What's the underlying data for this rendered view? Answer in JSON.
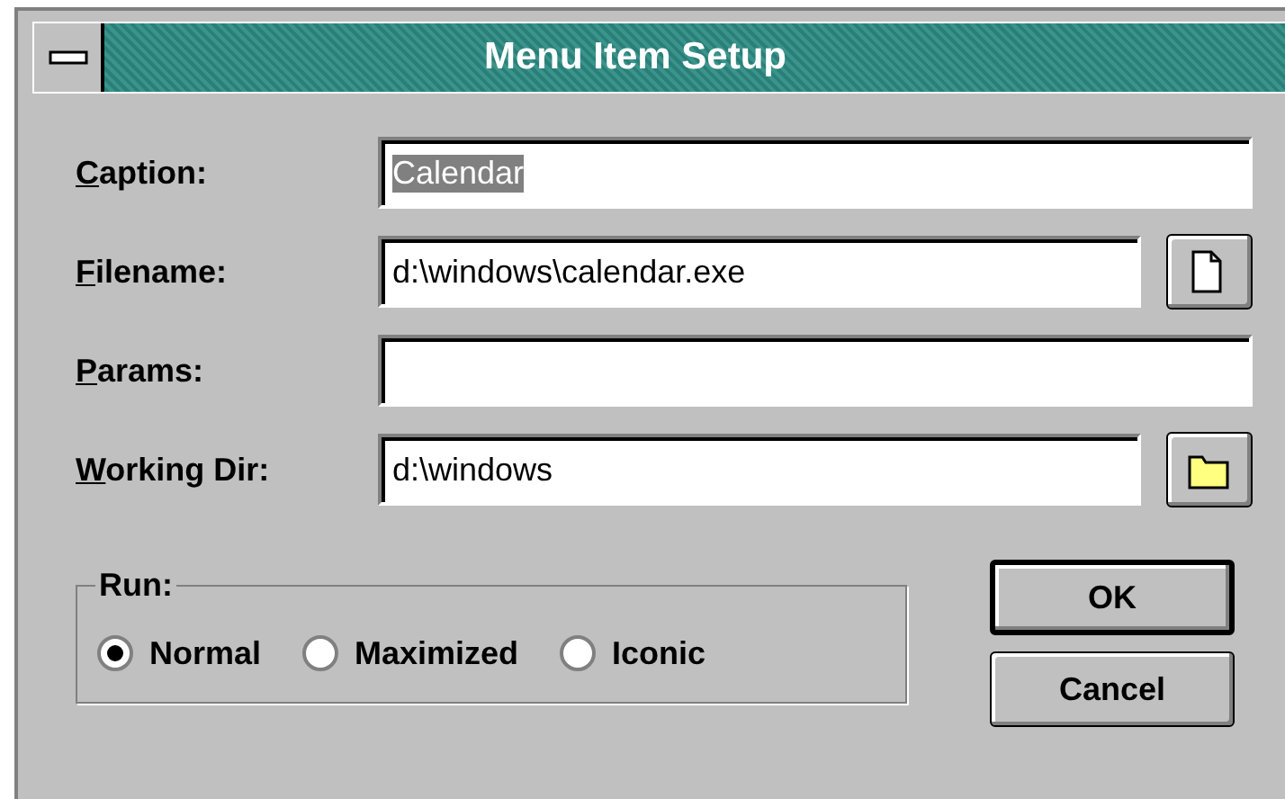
{
  "window": {
    "title": "Menu Item Setup"
  },
  "fields": [
    {
      "label": "Caption:",
      "value": "Calendar",
      "text_selected": true
    },
    {
      "label": "Filename:",
      "value": "d:\\windows\\calendar.exe",
      "kind": "file"
    },
    {
      "label": "Params:"
    },
    {
      "label": "Working Dir:",
      "value": "d:\\windows",
      "kind": "folder"
    }
  ],
  "run": {
    "label": "Run:",
    "options": [
      {
        "label": "Normal",
        "selected": true
      },
      {
        "label": "Maximized",
        "selected": false
      },
      {
        "label": "Iconic",
        "selected": false
      }
    ]
  },
  "buttons": [
    {
      "label": "OK",
      "default": true
    },
    {
      "label": "Cancel",
      "default": false
    }
  ]
}
